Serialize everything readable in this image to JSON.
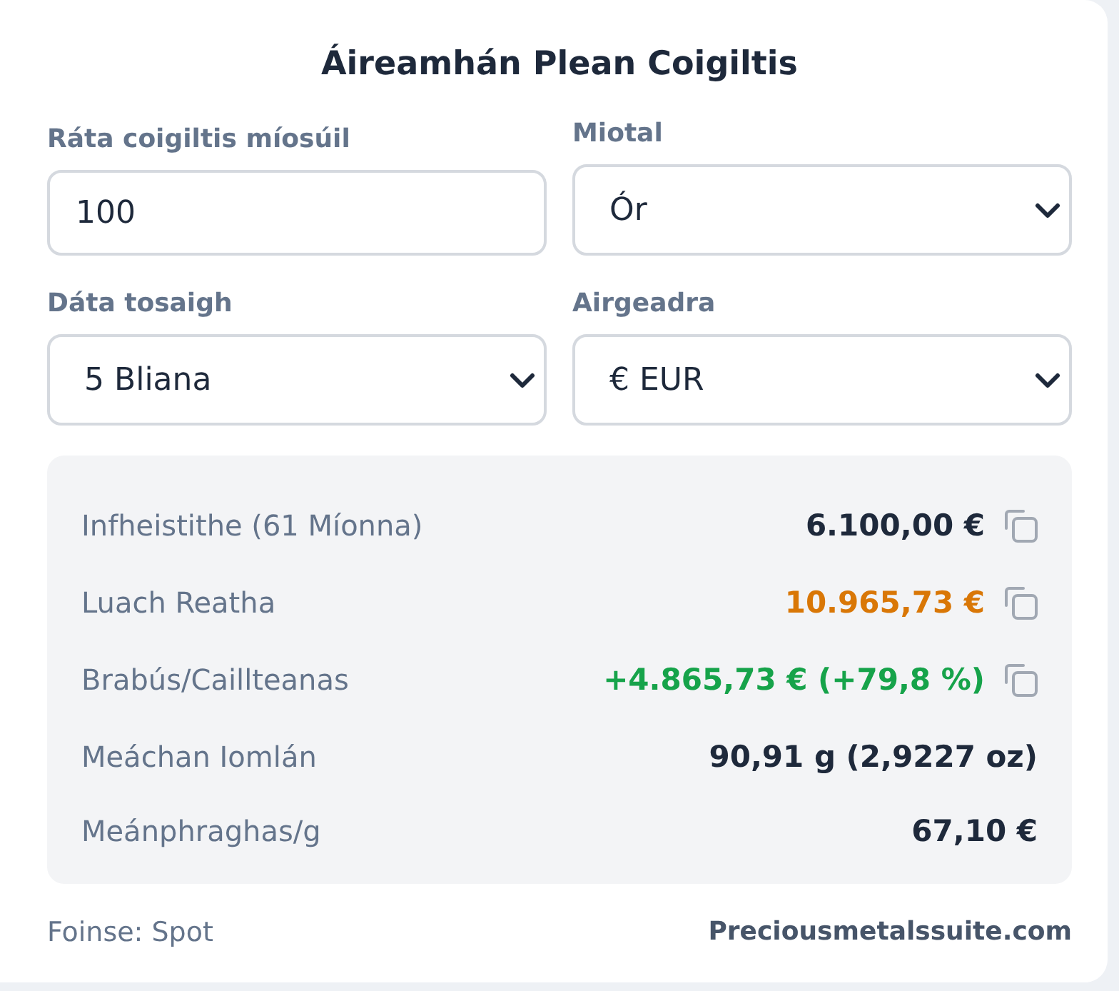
{
  "title": "Áireamhán Plean Coigiltis",
  "fields": [
    {
      "kind": "input",
      "label": "Ráta coigiltis míosúil",
      "value": "100"
    },
    {
      "kind": "select",
      "label": "Miotal",
      "value": "Ór"
    },
    {
      "kind": "select",
      "label": "Dáta tosaigh",
      "value": "5 Bliana"
    },
    {
      "kind": "select",
      "label": "Airgeadra",
      "value": "€ EUR"
    }
  ],
  "results": [
    {
      "label": "Infheistithe (61 Míonna)",
      "value": "6.100,00 €",
      "color": "#1e293b",
      "copyable": true
    },
    {
      "label": "Luach Reatha",
      "value": "10.965,73 €",
      "color": "#d97706",
      "copyable": true
    },
    {
      "label": "Brabús/Caillteanas",
      "value": "+4.865,73 € (+79,8 %)",
      "color": "#16a34a",
      "copyable": true
    },
    {
      "label": "Meáchan Iomlán",
      "value": "90,91 g (2,9227 oz)",
      "color": "#1e293b",
      "copyable": false
    },
    {
      "label": "Meánphraghas/g",
      "value": "67,10 €",
      "color": "#1e293b",
      "copyable": false
    }
  ],
  "footer": {
    "source": "Foinse: Spot",
    "link": "Preciousmetalssuite.com"
  }
}
